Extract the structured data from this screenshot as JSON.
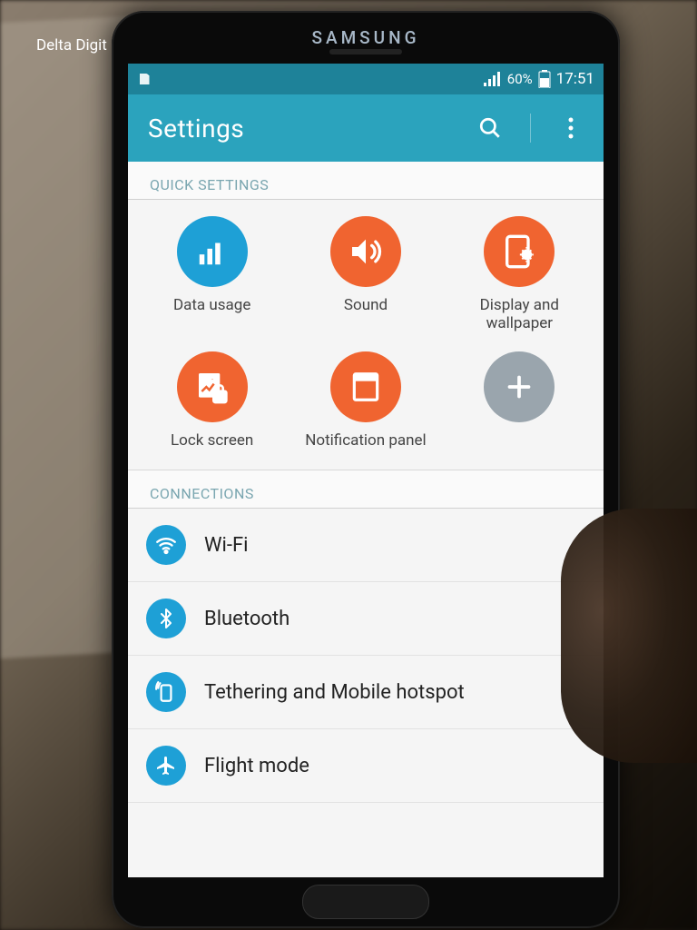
{
  "watermark": "Delta Digit",
  "phone_brand": "SAMSUNG",
  "statusbar": {
    "battery_pct": "60%",
    "time": "17:51"
  },
  "appbar": {
    "title": "Settings"
  },
  "sections": {
    "quick_header": "QUICK SETTINGS",
    "connections_header": "CONNECTIONS"
  },
  "quick": [
    {
      "label": "Data usage",
      "icon": "data-usage",
      "color": "blue"
    },
    {
      "label": "Sound",
      "icon": "sound",
      "color": "orange"
    },
    {
      "label": "Display and wallpaper",
      "icon": "display",
      "color": "orange"
    },
    {
      "label": "Lock screen",
      "icon": "lock-screen",
      "color": "orange"
    },
    {
      "label": "Notification panel",
      "icon": "notification-panel",
      "color": "orange"
    },
    {
      "label": "",
      "icon": "add",
      "color": "grey"
    }
  ],
  "connections": [
    {
      "label": "Wi-Fi",
      "icon": "wifi"
    },
    {
      "label": "Bluetooth",
      "icon": "bluetooth"
    },
    {
      "label": "Tethering and Mobile hotspot",
      "icon": "tethering"
    },
    {
      "label": "Flight mode",
      "icon": "flight-mode"
    }
  ],
  "colors": {
    "brand_blue": "#1ea0d6",
    "brand_orange": "#f06430",
    "appbar": "#2ba3bd",
    "statusbar": "#1e8299"
  }
}
